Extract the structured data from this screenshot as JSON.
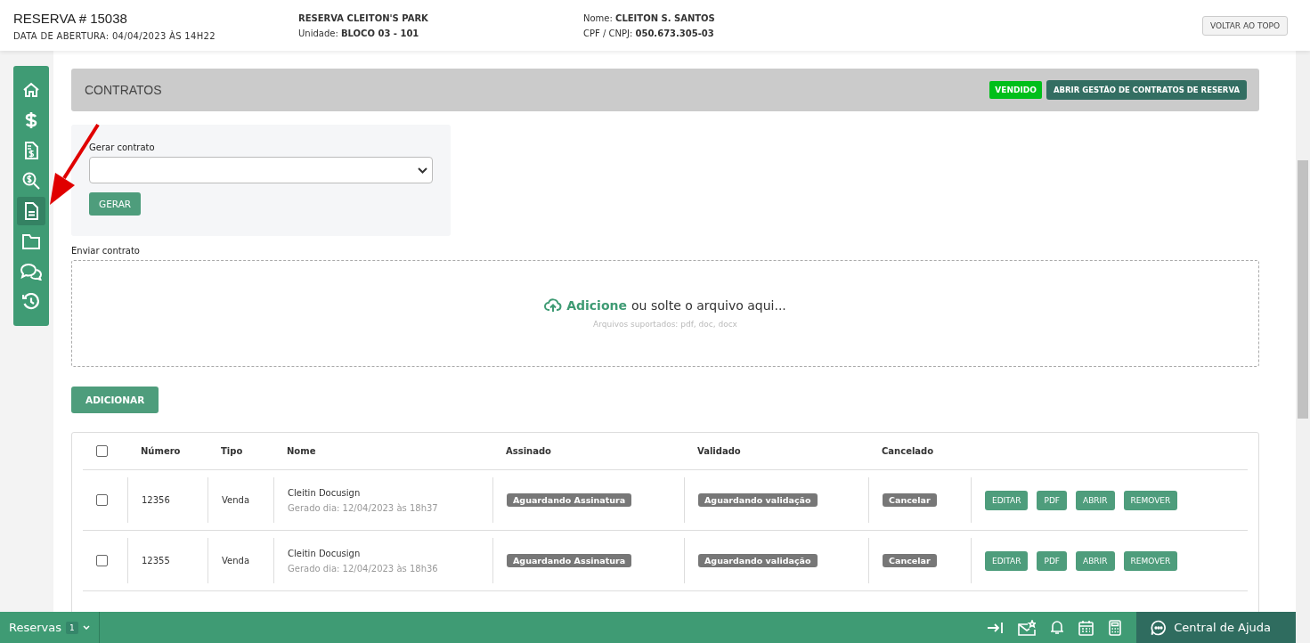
{
  "header": {
    "title": "RESERVA # 15038",
    "opened": "DATA DE ABERTURA: 04/04/2023 ÀS 14H22",
    "project": "RESERVA CLEITON'S PARK",
    "unit_label": "Unidade:",
    "unit": "BLOCO 03 - 101",
    "name_label": "Nome:",
    "name": "CLEITON S. SANTOS",
    "doc_label": "CPF / CNPJ:",
    "doc": "050.673.305-03",
    "back_button": "VOLTAR AO TOPO"
  },
  "sidebar": {
    "items": [
      {
        "kind": "home",
        "selected": false
      },
      {
        "kind": "dollar",
        "selected": false
      },
      {
        "kind": "invoice",
        "selected": false
      },
      {
        "kind": "search-money",
        "selected": false
      },
      {
        "kind": "document",
        "selected": true
      },
      {
        "kind": "folder",
        "selected": false
      },
      {
        "kind": "chat",
        "selected": false
      },
      {
        "kind": "history",
        "selected": false
      }
    ]
  },
  "section": {
    "title": "CONTRATOS",
    "status": "VENDIDO",
    "manage_button": "ABRIR GESTÃO DE CONTRATOS DE RESERVA"
  },
  "generate": {
    "label": "Gerar contrato",
    "button": "GERAR"
  },
  "upload": {
    "label": "Enviar contrato",
    "link": "Adicione",
    "text": "ou solte o arquivo aqui...",
    "hint": "Arquivos suportados: pdf, doc, docx"
  },
  "add_button": "ADICIONAR",
  "table": {
    "columns": [
      "Número",
      "Tipo",
      "Nome",
      "Assinado",
      "Validado",
      "Cancelado"
    ],
    "select_all": false,
    "rows": [
      {
        "checked": false,
        "number": "12356",
        "type": "Venda",
        "name": "Cleitin Docusign",
        "date": "Gerado dia: 12/04/2023 às 18h37",
        "signed": "Aguardando Assinatura",
        "validated": "Aguardando validação",
        "cancel": "Cancelar",
        "actions": [
          "EDITAR",
          "PDF",
          "ABRIR",
          "REMOVER"
        ]
      },
      {
        "checked": false,
        "number": "12355",
        "type": "Venda",
        "name": "Cleitin Docusign",
        "date": "Gerado dia: 12/04/2023 às 18h36",
        "signed": "Aguardando Assinatura",
        "validated": "Aguardando validação",
        "cancel": "Cancelar",
        "actions": [
          "EDITAR",
          "PDF",
          "ABRIR",
          "REMOVER"
        ]
      }
    ]
  },
  "bottom_bar": {
    "tab": "Reservas",
    "count": "1",
    "help": "Central de Ajuda"
  }
}
